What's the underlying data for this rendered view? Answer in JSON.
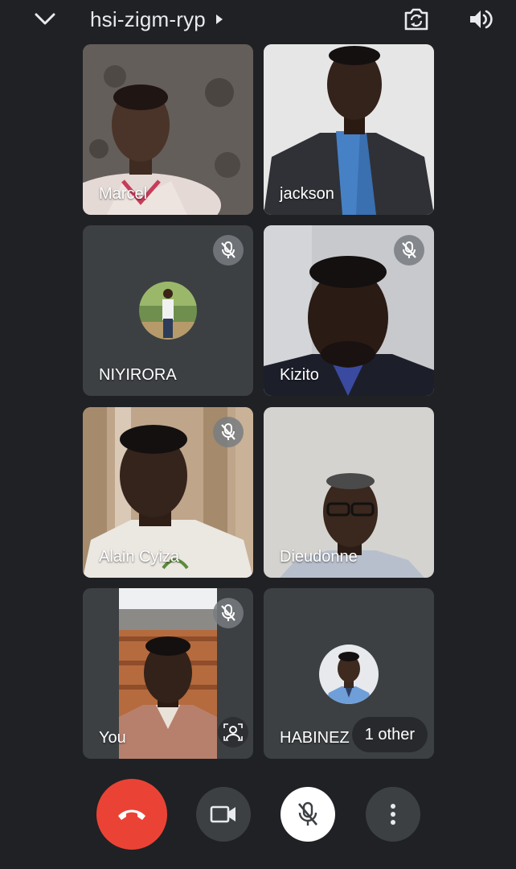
{
  "header": {
    "meeting_code": "hsi-zigm-ryp"
  },
  "participants": [
    {
      "name": "Marcel",
      "muted": false
    },
    {
      "name": "jackson",
      "muted": false
    },
    {
      "name": "NIYIRORA",
      "muted": true
    },
    {
      "name": "Kizito",
      "muted": true
    },
    {
      "name": "Alain Cyiza",
      "muted": true
    },
    {
      "name": "Dieudonne",
      "muted": false
    },
    {
      "name": "You",
      "muted": true
    },
    {
      "name": "HABINEZ",
      "muted": false
    }
  ],
  "overflow": {
    "label": "1 other"
  },
  "controls": {
    "end_call": "end-call",
    "camera": "camera-on",
    "mic": "mic-off",
    "more": "more-options"
  },
  "colors": {
    "background": "#202124",
    "tile": "#3c4043",
    "end_call": "#ea4335",
    "control": "#3c4043",
    "mic_button": "#ffffff"
  }
}
